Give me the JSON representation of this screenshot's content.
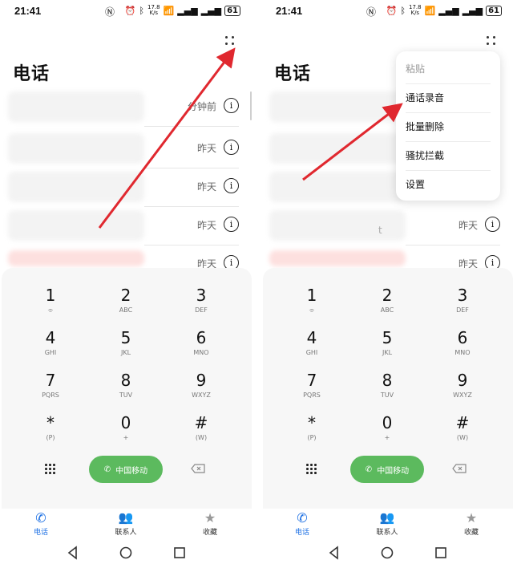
{
  "status": {
    "time": "21:41",
    "speed_value": "17.8",
    "speed_unit": "K/s",
    "battery": "61"
  },
  "app": {
    "title": "电话"
  },
  "call_log": [
    {
      "time": "分钟前",
      "blur": "normal"
    },
    {
      "time": "昨天",
      "blur": "normal"
    },
    {
      "time": "昨天",
      "blur": "normal"
    },
    {
      "time": "昨天",
      "blur": "normal"
    },
    {
      "time": "昨天",
      "blur": "red"
    }
  ],
  "right_call_log": [
    {
      "time": "昨天",
      "suffix": "t"
    },
    {
      "time": "昨天",
      "suffix": ""
    }
  ],
  "dialpad": [
    {
      "digit": "1",
      "sub": "voicemail-icon"
    },
    {
      "digit": "2",
      "sub": "ABC"
    },
    {
      "digit": "3",
      "sub": "DEF"
    },
    {
      "digit": "4",
      "sub": "GHI"
    },
    {
      "digit": "5",
      "sub": "JKL"
    },
    {
      "digit": "6",
      "sub": "MNO"
    },
    {
      "digit": "7",
      "sub": "PQRS"
    },
    {
      "digit": "8",
      "sub": "TUV"
    },
    {
      "digit": "9",
      "sub": "WXYZ"
    },
    {
      "digit": "*",
      "sub": "(P)"
    },
    {
      "digit": "0",
      "sub": "+"
    },
    {
      "digit": "#",
      "sub": "(W)"
    }
  ],
  "call_button": {
    "label": "中国移动"
  },
  "tabs": [
    {
      "label": "电话",
      "icon": "phone-icon",
      "active": true
    },
    {
      "label": "联系人",
      "icon": "contacts-icon",
      "active": false
    },
    {
      "label": "收藏",
      "icon": "star-icon",
      "active": false
    }
  ],
  "menu": {
    "items": [
      {
        "label": "粘贴",
        "disabled": true
      },
      {
        "label": "通话录音",
        "disabled": false
      },
      {
        "label": "批量删除",
        "disabled": false
      },
      {
        "label": "骚扰拦截",
        "disabled": false
      },
      {
        "label": "设置",
        "disabled": false
      }
    ]
  },
  "colors": {
    "accent": "#1a6ee3",
    "call": "#5cba5e",
    "arrow": "#e0282f"
  }
}
